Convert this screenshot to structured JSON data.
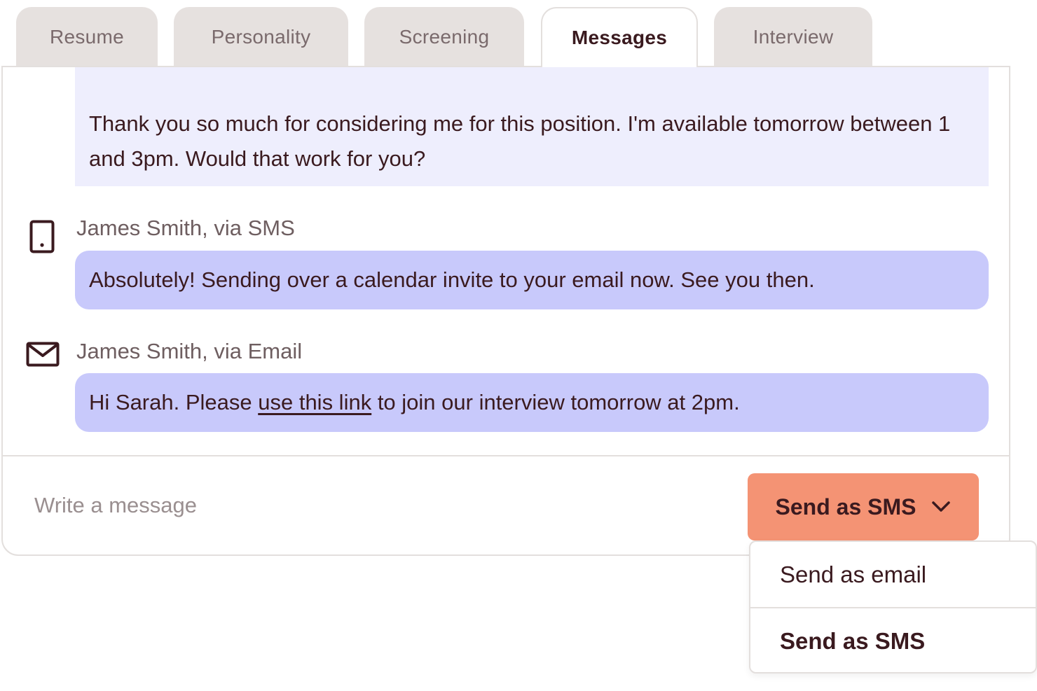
{
  "tabs": [
    {
      "label": "Resume"
    },
    {
      "label": "Personality"
    },
    {
      "label": "Screening"
    },
    {
      "label": "Messages",
      "active": true
    },
    {
      "label": "Interview"
    }
  ],
  "messages": [
    {
      "text": "Thank you so much for considering me for this position. I'm available tomorrow between 1 and 3pm. Would that work for you?"
    },
    {
      "sender": "James Smith, via SMS",
      "channel_icon": "phone-icon",
      "text": "Absolutely! Sending over a calendar invite to your email now. See you then."
    },
    {
      "sender": "James Smith, via Email",
      "channel_icon": "mail-icon",
      "text_before": "Hi Sarah. Please ",
      "link_text": "use this link",
      "text_after": " to join our interview tomorrow at 2pm."
    }
  ],
  "composer": {
    "placeholder": "Write a message"
  },
  "send_button": {
    "label": "Send as SMS",
    "icon": "chevron-down-icon"
  },
  "send_options": [
    {
      "label": "Send as email"
    },
    {
      "label": "Send as SMS",
      "selected": true
    }
  ],
  "colors": {
    "accent": "#f49374",
    "bubble_incoming": "#eeeefd",
    "bubble_outgoing": "#c8c9fb",
    "text": "#3a1a1f"
  }
}
